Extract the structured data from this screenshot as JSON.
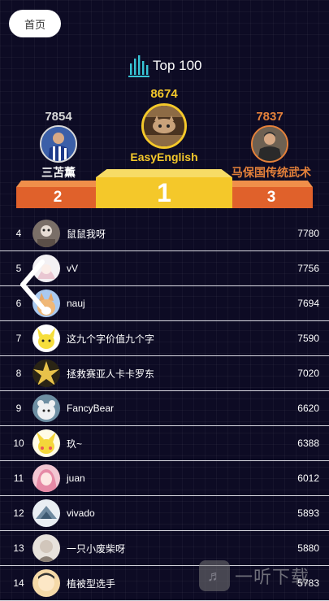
{
  "header": {
    "home_label": "首页",
    "title": "Top 100"
  },
  "colors": {
    "background": "#0d0b24",
    "gold": "#f4c82a",
    "silver": "#d8d8d8",
    "bronze": "#e5813a",
    "step_orange": "#e0612b"
  },
  "podium": {
    "first": {
      "rank": "1",
      "name": "EasyEnglish",
      "score": "8674",
      "avatar_icon": "cat-avatar"
    },
    "second": {
      "rank": "2",
      "name": "三苫薰",
      "score": "7854",
      "avatar_icon": "soccer-player-avatar"
    },
    "third": {
      "rank": "3",
      "name": "马保国传统武术",
      "score": "7837",
      "avatar_icon": "man-avatar"
    }
  },
  "list": [
    {
      "rank": "4",
      "name": "鼠鼠我呀",
      "score": "7780"
    },
    {
      "rank": "5",
      "name": "vV",
      "score": "7756"
    },
    {
      "rank": "6",
      "name": "nauj",
      "score": "7694"
    },
    {
      "rank": "7",
      "name": "这九个字价值九个字",
      "score": "7590"
    },
    {
      "rank": "8",
      "name": "拯救赛亚人卡卡罗东",
      "score": "7020"
    },
    {
      "rank": "9",
      "name": "FancyBear",
      "score": "6620"
    },
    {
      "rank": "10",
      "name": "玖~",
      "score": "6388"
    },
    {
      "rank": "11",
      "name": "juan",
      "score": "6012"
    },
    {
      "rank": "12",
      "name": "vivado",
      "score": "5893"
    },
    {
      "rank": "13",
      "name": "一只小废柴呀",
      "score": "5880"
    },
    {
      "rank": "14",
      "name": "植被型选手",
      "score": "5783"
    }
  ],
  "watermark": {
    "text": "一听下载"
  }
}
